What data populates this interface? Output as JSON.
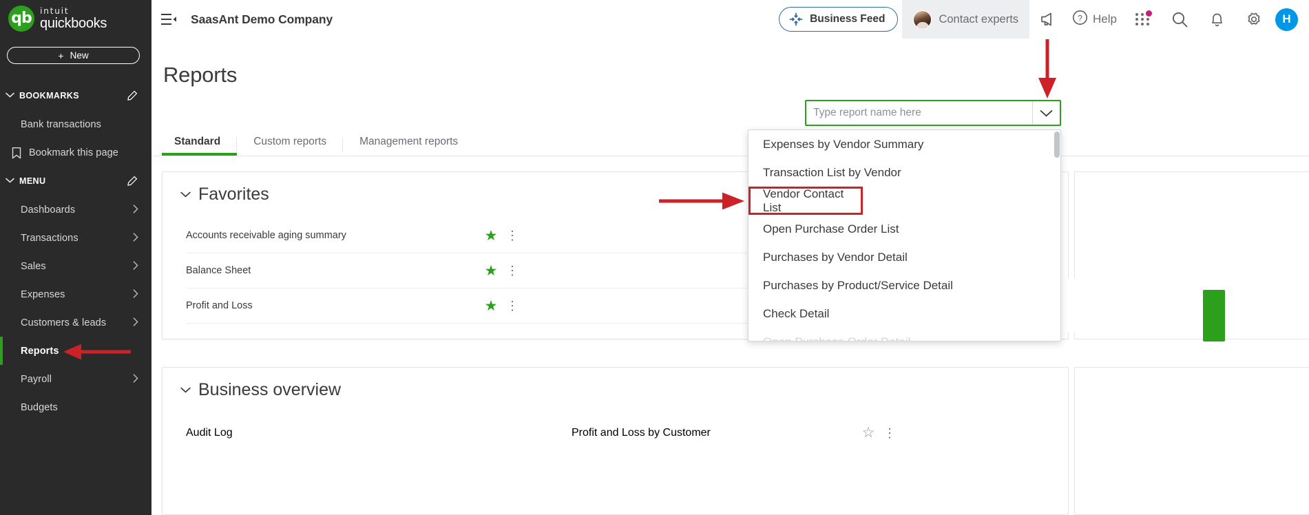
{
  "brand": {
    "intuit": "intuit",
    "product": "quickbooks",
    "mark_letters": "qb",
    "green": "#2ca01c"
  },
  "sidebar": {
    "new_button": {
      "label": "New",
      "plus": "+"
    },
    "sections": [
      {
        "label": "BOOKMARKS",
        "caret": "chevron-down"
      },
      {
        "label": "MENU",
        "caret": "chevron-down"
      }
    ],
    "bookmarks": [
      {
        "label": "Bank transactions",
        "icon": null,
        "chevron": false
      },
      {
        "label": "Bookmark this page",
        "icon": "bookmark-icon",
        "chevron": false
      }
    ],
    "menu": [
      {
        "label": "Dashboards",
        "chevron": true,
        "active": false
      },
      {
        "label": "Transactions",
        "chevron": true,
        "active": false
      },
      {
        "label": "Sales",
        "chevron": true,
        "active": false
      },
      {
        "label": "Expenses",
        "chevron": true,
        "active": false
      },
      {
        "label": "Customers & leads",
        "chevron": true,
        "active": false
      },
      {
        "label": "Reports",
        "chevron": false,
        "active": true
      },
      {
        "label": "Payroll",
        "chevron": true,
        "active": false
      },
      {
        "label": "Budgets",
        "chevron": false,
        "active": false
      }
    ]
  },
  "header": {
    "hamburger_icon": "hamburger-collapse-icon",
    "company_name": "SaasAnt Demo Company",
    "business_feed_label": "Business Feed",
    "contact_experts_label": "Contact experts",
    "megaphone_icon": "megaphone-icon",
    "help_label": "Help",
    "apps_grid_icon": "apps-grid-icon",
    "search_icon": "search-icon",
    "bell_icon": "notification-bell-icon",
    "gear_icon": "gear-icon",
    "avatar_initial": "H",
    "avatar_color": "#0097e6"
  },
  "main": {
    "page_title": "Reports",
    "tabs": [
      {
        "label": "Standard",
        "active": true
      },
      {
        "label": "Custom reports",
        "active": false
      },
      {
        "label": "Management reports",
        "active": false
      }
    ]
  },
  "favorites": {
    "title": "Favorites",
    "caret": "chevron-down",
    "rows": [
      {
        "name": "Accounts receivable aging summary",
        "starred": true
      },
      {
        "name": "Balance Sheet",
        "starred": true
      },
      {
        "name": "Profit and Loss",
        "starred": true
      }
    ]
  },
  "business_overview": {
    "title": "Business overview",
    "caret": "chevron-down",
    "rows": [
      {
        "left": "Audit Log",
        "right": "Profit and Loss by Customer",
        "right_starred": false
      }
    ]
  },
  "search": {
    "placeholder": "Type report name here",
    "value": "",
    "dropdown_icon": "chevron-down-icon"
  },
  "dropdown": {
    "items": [
      {
        "label": "Expenses by Vendor Summary",
        "highlighted": false
      },
      {
        "label": "Transaction List by Vendor",
        "highlighted": false
      },
      {
        "label": "Vendor Contact List",
        "highlighted": true
      },
      {
        "label": "Open Purchase Order List",
        "highlighted": false
      },
      {
        "label": "Purchases by Vendor Detail",
        "highlighted": false
      },
      {
        "label": "Purchases by Product/Service Detail",
        "highlighted": false
      },
      {
        "label": "Check Detail",
        "highlighted": false
      },
      {
        "label": "Open Purchase Order Detail",
        "highlighted": false
      }
    ]
  },
  "annotations": {
    "color": "#cc2127",
    "arrows": [
      {
        "name": "arrow-to-dropdown-toggle",
        "target": "search dropdown chevron"
      },
      {
        "name": "arrow-to-vendor-contact-list",
        "target": "Vendor Contact List item"
      },
      {
        "name": "arrow-to-reports-nav",
        "target": "Reports sidebar item"
      }
    ],
    "boxes": [
      {
        "name": "highlight-box-vendor-contact-list",
        "target": "Vendor Contact List item"
      }
    ]
  }
}
